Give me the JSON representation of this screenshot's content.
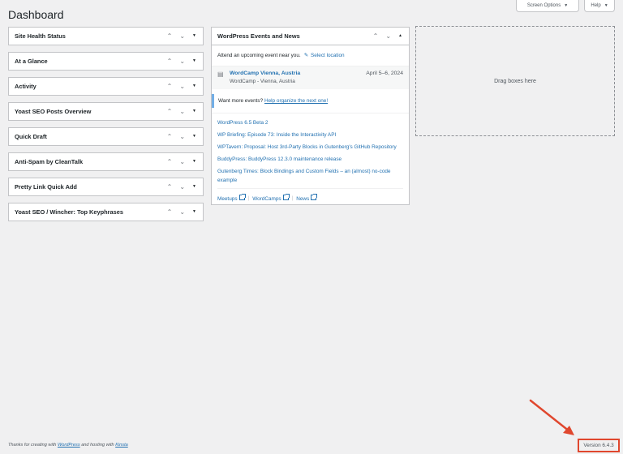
{
  "page": {
    "title": "Dashboard"
  },
  "screen_meta": {
    "screen_options_label": "Screen Options",
    "help_label": "Help"
  },
  "column1": {
    "boxes": [
      {
        "title": "Site Health Status"
      },
      {
        "title": "At a Glance"
      },
      {
        "title": "Activity"
      },
      {
        "title": "Yoast SEO Posts Overview"
      },
      {
        "title": "Quick Draft"
      },
      {
        "title": "Anti-Spam by CleanTalk"
      },
      {
        "title": "Pretty Link Quick Add"
      },
      {
        "title": "Yoast SEO / Wincher: Top Keyphrases"
      }
    ]
  },
  "events": {
    "title": "WordPress Events and News",
    "attend_text": "Attend an upcoming event near you.",
    "select_location": "Select location",
    "event": {
      "name": "WordCamp Vienna, Austria",
      "location": "WordCamp - Vienna, Austria",
      "date": "April 5–6, 2024"
    },
    "more_prefix": "Want more events?",
    "more_link": "Help organize the next one!",
    "news": [
      "WordPress 6.5 Beta 2",
      "WP Briefing: Episode 73: Inside the Interactivity API",
      "WPTavern: Proposal: Host 3rd-Party Blocks in Gutenberg's GitHub Repository",
      "BuddyPress: BuddyPress 12.3.0 maintenance release",
      "Gutenberg Times: Block Bindings and Custom Fields – an (almost) no-code example"
    ],
    "footer_links": {
      "meetups": "Meetups",
      "wordcamps": "WordCamps",
      "news": "News",
      "separator": "|"
    }
  },
  "drop_zone": {
    "label": "Drag boxes here"
  },
  "footer": {
    "thanks_prefix": "Thanks for creating with",
    "wordpress_link": "WordPress",
    "middle": "and hosting with",
    "kinsta_link": "Kinsta",
    "version": "Version 6.4.3"
  },
  "icons": {
    "up": "chevron-up-icon",
    "down": "chevron-down-icon",
    "toggle": "toggle-triangle-icon",
    "location": "location-icon",
    "event": "calendar-icon",
    "external": "external-link-icon"
  },
  "colors": {
    "link": "#2271b1",
    "highlight": "#e0472e",
    "background": "#f0f0f1"
  }
}
